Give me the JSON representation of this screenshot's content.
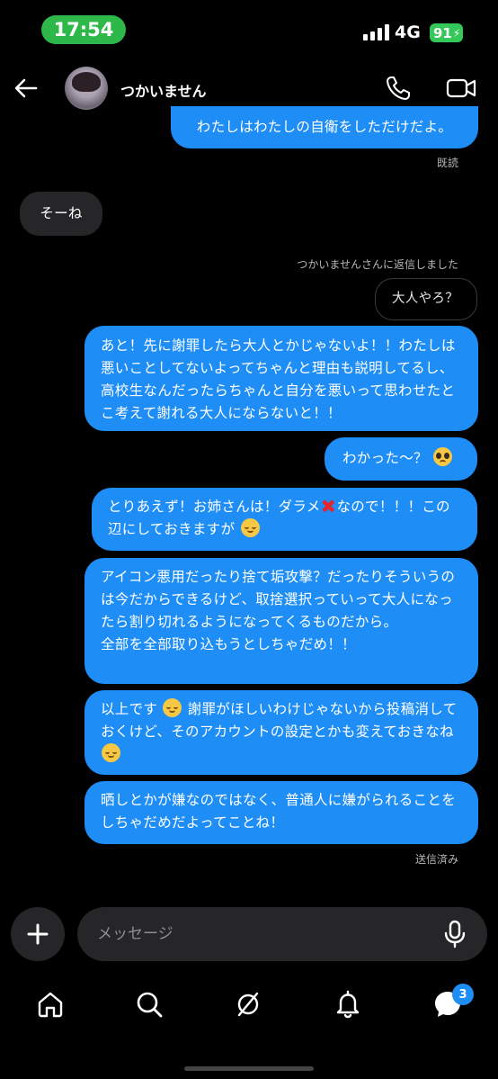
{
  "status_bar": {
    "time": "17:54",
    "network": "4G",
    "battery": "91"
  },
  "header": {
    "contact_name": "つかいません"
  },
  "messages": {
    "m1": "わたしはわたしの自衛をしただけだよ。",
    "read_receipt": "既読",
    "m2": "そーね",
    "reply_note": "つかいませんさんに返信しました",
    "reply_quote": "大人やろ？",
    "m3": "あと！先に謝罪したら大人とかじゃないよ！！わたしは悪いことしてないよってちゃんと理由も説明してるし、高校生なんだったらちゃんと自分を悪いって思わせたとこ考えて謝れる大人にならないと！！",
    "m4": "わかった〜？",
    "m5a": "とりあえず！お姉さんは！ダラメ",
    "m5b": "なので！！！この辺にしておきますが",
    "m6": "アイコン悪用だったり捨て垢攻撃？だったりそういうのは今だからできるけど、取捨選択っていって大人になったら割り切れるようになってくるものだから。\n全部を全部取り込もうとしちゃだめ！！",
    "m7a": "以上です",
    "m7b": "謝罪がほしいわけじゃないから投稿消しておくけど、そのアカウントの設定とかも変えておきなね",
    "m8": "晒しとかが嫌なのではなく、普通人に嫌がられることをしちゃだめだよってことね！",
    "sent_status": "送信済み"
  },
  "composer": {
    "placeholder": "メッセージ"
  },
  "tabbar": {
    "messages_badge": "3"
  },
  "icons": {
    "back": "back-arrow-icon",
    "call": "phone-icon",
    "video": "video-camera-icon",
    "plus": "plus-icon",
    "mic": "microphone-icon",
    "home": "home-icon",
    "search": "search-icon",
    "explore": "explore-icon",
    "notifications": "bell-icon",
    "messages": "chat-bubble-icon"
  },
  "colors": {
    "sent_bubble": "#1e8df5",
    "received_bubble": "#262628",
    "time_pill": "#2fb84a",
    "battery": "#34c759"
  }
}
